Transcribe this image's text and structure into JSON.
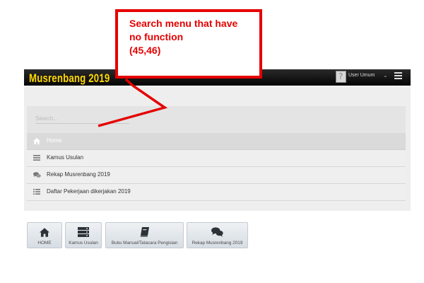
{
  "annotation": {
    "text": "Search menu that have\nno function\n(45,46)"
  },
  "header": {
    "brand": "Musrenbang 2019",
    "user_label": "User Umum",
    "avatar_icon": "user-avatar-icon",
    "menu_icon": "hamburger-icon",
    "chevron_icon": "chevron-down-icon"
  },
  "search": {
    "placeholder": "Search..."
  },
  "menu": {
    "items": [
      {
        "label": "Home",
        "icon": "home-icon",
        "active": true
      },
      {
        "label": "Kamus Usulan",
        "icon": "list-icon",
        "active": false
      },
      {
        "label": "Rekap Musrenbang 2019",
        "icon": "comments-icon",
        "active": false
      },
      {
        "label": "Daftar Pekerjaan dikerjakan 2019",
        "icon": "list-icon",
        "active": false
      }
    ]
  },
  "tiles": [
    {
      "label": "HOME",
      "icon": "home-icon"
    },
    {
      "label": "Kamus Usulan",
      "icon": "server-list-icon"
    },
    {
      "label": "Buku Manual/Tatacara Pengisian",
      "icon": "book-icon"
    },
    {
      "label": "Rekap Musrenbang 2019",
      "icon": "comments-icon"
    }
  ],
  "colors": {
    "annotation_red": "#e50000",
    "brand_yellow": "#ffd800",
    "header_black": "#050505",
    "panel_gray": "#eeeeee"
  }
}
